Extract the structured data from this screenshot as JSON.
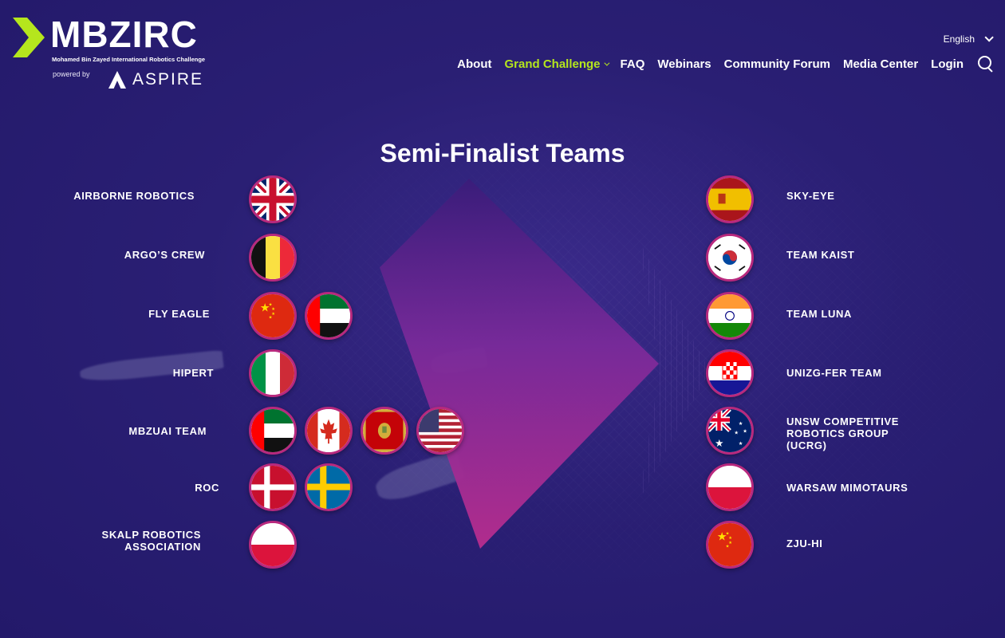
{
  "brand": {
    "logo_text": "MBZIRC",
    "logo_subtitle": "Mohamed Bin Zayed International Robotics Challenge",
    "powered_by": "powered by",
    "partner": "ASPIRE"
  },
  "language": {
    "selected": "English"
  },
  "nav": {
    "items": [
      {
        "label": "About"
      },
      {
        "label": "Grand Challenge",
        "active": true
      },
      {
        "label": "FAQ"
      },
      {
        "label": "Webinars"
      },
      {
        "label": "Community Forum"
      },
      {
        "label": "Media Center"
      },
      {
        "label": "Login"
      }
    ]
  },
  "page": {
    "title": "Semi-Finalist Teams"
  },
  "colors": {
    "accent": "#b5e61d",
    "flag_ring": "#b8297e",
    "background": "#2a1f74"
  },
  "teams_left": [
    {
      "name": "AIRBORNE ROBOTICS",
      "flags": [
        "uk"
      ]
    },
    {
      "name": "ARGO’S CREW",
      "flags": [
        "belgium"
      ]
    },
    {
      "name": "FLY EAGLE",
      "flags": [
        "china",
        "uae"
      ]
    },
    {
      "name": "HIPERT",
      "flags": [
        "italy"
      ]
    },
    {
      "name": "MBZUAI TEAM",
      "flags": [
        "uae",
        "canada",
        "montenegro",
        "usa"
      ]
    },
    {
      "name": "ROC",
      "flags": [
        "denmark",
        "sweden"
      ]
    },
    {
      "name": "SKALP ROBOTICS ASSOCIATION",
      "flags": [
        "poland"
      ]
    }
  ],
  "teams_right": [
    {
      "name": "SKY-EYE",
      "flags": [
        "spain"
      ]
    },
    {
      "name": "TEAM KAIST",
      "flags": [
        "south-korea"
      ]
    },
    {
      "name": "TEAM LUNA",
      "flags": [
        "india"
      ]
    },
    {
      "name": "UNIZG-FER TEAM",
      "flags": [
        "croatia"
      ]
    },
    {
      "name": "UNSW COMPETITIVE ROBOTICS GROUP (UCRG)",
      "flags": [
        "australia"
      ]
    },
    {
      "name": "WARSAW MIMOTAURS",
      "flags": [
        "poland"
      ]
    },
    {
      "name": "ZJU-HI",
      "flags": [
        "china"
      ]
    }
  ]
}
